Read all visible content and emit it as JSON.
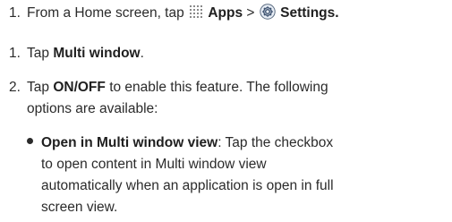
{
  "steps": {
    "step1": {
      "number": "1.",
      "prefix": "From a Home screen, tap",
      "apps_label": "Apps",
      "separator": ">",
      "settings_label": "Settings."
    },
    "step1b": {
      "number": "1.",
      "prefix": "Tap",
      "bold": "Multi window",
      "suffix": "."
    },
    "step2": {
      "number": "2.",
      "prefix": "Tap",
      "bold": "ON/OFF",
      "line1_rest": "to enable this feature. The following",
      "line2": "options are available:"
    }
  },
  "bullet": {
    "bold": "Open in Multi window view",
    "line1_rest": ": Tap the checkbox",
    "line2": "to open content in Multi window view",
    "line3": "automatically when an application is open in full",
    "line4": "screen view."
  },
  "icons": {
    "apps": "apps-grid-icon",
    "settings": "gear-icon"
  }
}
